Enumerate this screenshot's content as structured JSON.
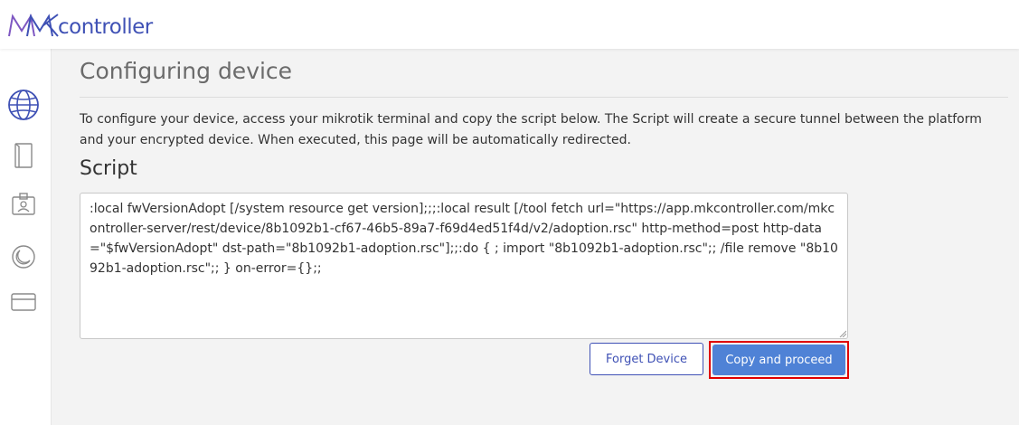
{
  "header": {
    "logo_text": "controller"
  },
  "sidebar": {
    "items": [
      {
        "icon": "globe-icon"
      },
      {
        "icon": "book-icon"
      },
      {
        "icon": "id-badge-icon"
      },
      {
        "icon": "moon-icon"
      },
      {
        "icon": "credit-card-icon"
      }
    ]
  },
  "main": {
    "title": "Configuring device",
    "description": "To configure your device, access your mikrotik terminal and copy the script below. The Script will create a secure tunnel between the platform and your encrypted device. When executed, this page will be automatically redirected.",
    "script_label": "Script",
    "script_value": ":local fwVersionAdopt [/system resource get version];;;:local result [/tool fetch url=\"https://app.mkcontroller.com/mkcontroller-server/rest/device/8b1092b1-cf67-46b5-89a7-f69d4ed51f4d/v2/adoption.rsc\" http-method=post http-data=\"$fwVersionAdopt\" dst-path=\"8b1092b1-adoption.rsc\"];;:do { ; import \"8b1092b1-adoption.rsc\";; /file remove \"8b1092b1-adoption.rsc\";; } on-error={};;",
    "forget_label": "Forget Device",
    "proceed_label": "Copy and proceed"
  },
  "colors": {
    "brand": "#3f51b5",
    "primary_button": "#4f82d6",
    "highlight": "#e00000"
  }
}
